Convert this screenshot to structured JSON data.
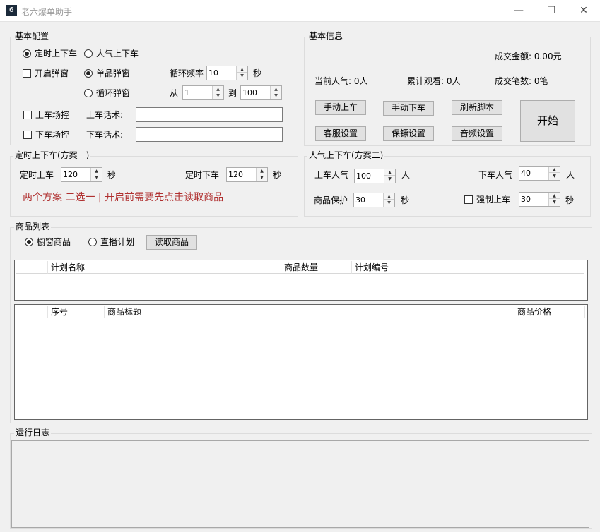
{
  "window": {
    "app_icon_text": "6",
    "title": "老六爆单助手",
    "minimize": "—",
    "maximize": "☐",
    "close": "✕"
  },
  "basic_config": {
    "title": "基本配置",
    "timed": "定时上下车",
    "popularity": "人气上下车",
    "popup_enable": "开启弹窗",
    "single_popup": "单品弹窗",
    "loop_freq_label": "循环频率",
    "loop_freq_value": "10",
    "sec": "秒",
    "loop_popup": "循环弹窗",
    "from": "从",
    "from_value": "1",
    "to": "到",
    "to_value": "100",
    "on_control": "上车场控",
    "on_talk_label": "上车话术:",
    "on_talk_value": "",
    "off_control": "下车场控",
    "off_talk_label": "下车话术:",
    "off_talk_value": ""
  },
  "basic_info": {
    "title": "基本信息",
    "deal_amount": "成交金额: 0.00元",
    "current_pop": "当前人气: 0人",
    "total_watch": "累计观看: 0人",
    "deal_count": "成交笔数: 0笔",
    "manual_on": "手动上车",
    "manual_off": "手动下车",
    "refresh_script": "刷新脚本",
    "start": "开始",
    "service_settings": "客服设置",
    "save_settings": "保镖设置",
    "audio_settings": "音频设置"
  },
  "plan_one": {
    "title": "定时上下车(方案一)",
    "on_label": "定时上车",
    "on_value": "120",
    "off_label": "定时下车",
    "off_value": "120",
    "sec": "秒",
    "note": "两个方案  二选一  |  开启前需要先点击读取商品"
  },
  "plan_two": {
    "title": "人气上下车(方案二)",
    "on_pop_label": "上车人气",
    "on_pop_value": "100",
    "person": "人",
    "off_pop_label": "下车人气",
    "off_pop_value": "40",
    "protect_label": "商品保护",
    "protect_value": "30",
    "sec": "秒",
    "force_label": "强制上车",
    "force_value": "30"
  },
  "products": {
    "title": "商品列表",
    "window_goods": "橱窗商品",
    "live_plan": "直播计划",
    "read_button": "读取商品",
    "plan_columns": [
      "",
      "计划名称",
      "商品数量",
      "计划编号"
    ],
    "goods_columns": [
      "",
      "序号",
      "商品标题",
      "商品价格"
    ]
  },
  "log": {
    "title": "运行日志"
  }
}
